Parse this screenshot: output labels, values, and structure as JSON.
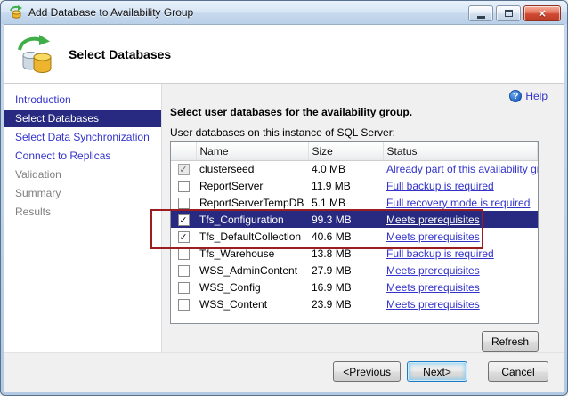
{
  "window": {
    "title": "Add Database to Availability Group"
  },
  "header": {
    "title": "Select Databases"
  },
  "sidebar": {
    "items": [
      {
        "label": "Introduction",
        "state": "enabled"
      },
      {
        "label": "Select Databases",
        "state": "selected"
      },
      {
        "label": "Select Data Synchronization",
        "state": "enabled"
      },
      {
        "label": "Connect to Replicas",
        "state": "enabled"
      },
      {
        "label": "Validation",
        "state": "disabled"
      },
      {
        "label": "Summary",
        "state": "disabled"
      },
      {
        "label": "Results",
        "state": "disabled"
      }
    ]
  },
  "main": {
    "help_label": "Help",
    "heading": "Select user databases for the availability group.",
    "subheading": "User databases on this instance of SQL Server:",
    "table": {
      "columns": [
        "Name",
        "Size",
        "Status"
      ],
      "rows": [
        {
          "checked": true,
          "disabled": true,
          "selected": false,
          "name": "clusterseed",
          "size": "4.0 MB",
          "status": "Already part of this availability group"
        },
        {
          "checked": false,
          "disabled": false,
          "selected": false,
          "name": "ReportServer",
          "size": "11.9 MB",
          "status": "Full backup is required"
        },
        {
          "checked": false,
          "disabled": false,
          "selected": false,
          "name": "ReportServerTempDB",
          "size": "5.1 MB",
          "status": "Full recovery mode is required"
        },
        {
          "checked": true,
          "disabled": false,
          "selected": true,
          "name": "Tfs_Configuration",
          "size": "99.3 MB",
          "status": "Meets prerequisites"
        },
        {
          "checked": true,
          "disabled": false,
          "selected": false,
          "name": "Tfs_DefaultCollection",
          "size": "40.6 MB",
          "status": "Meets prerequisites"
        },
        {
          "checked": false,
          "disabled": false,
          "selected": false,
          "name": "Tfs_Warehouse",
          "size": "13.8 MB",
          "status": "Full backup is required"
        },
        {
          "checked": false,
          "disabled": false,
          "selected": false,
          "name": "WSS_AdminContent",
          "size": "27.9 MB",
          "status": "Meets prerequisites"
        },
        {
          "checked": false,
          "disabled": false,
          "selected": false,
          "name": "WSS_Config",
          "size": "16.9 MB",
          "status": "Meets prerequisites"
        },
        {
          "checked": false,
          "disabled": false,
          "selected": false,
          "name": "WSS_Content",
          "size": "23.9 MB",
          "status": "Meets prerequisites"
        }
      ]
    },
    "refresh_label": "Refresh"
  },
  "footer": {
    "previous_label": "<Previous",
    "next_label": "Next>",
    "cancel_label": "Cancel"
  },
  "colors": {
    "selection": "#272a80",
    "link": "#3333cc",
    "annotation": "#9c1d1f"
  }
}
